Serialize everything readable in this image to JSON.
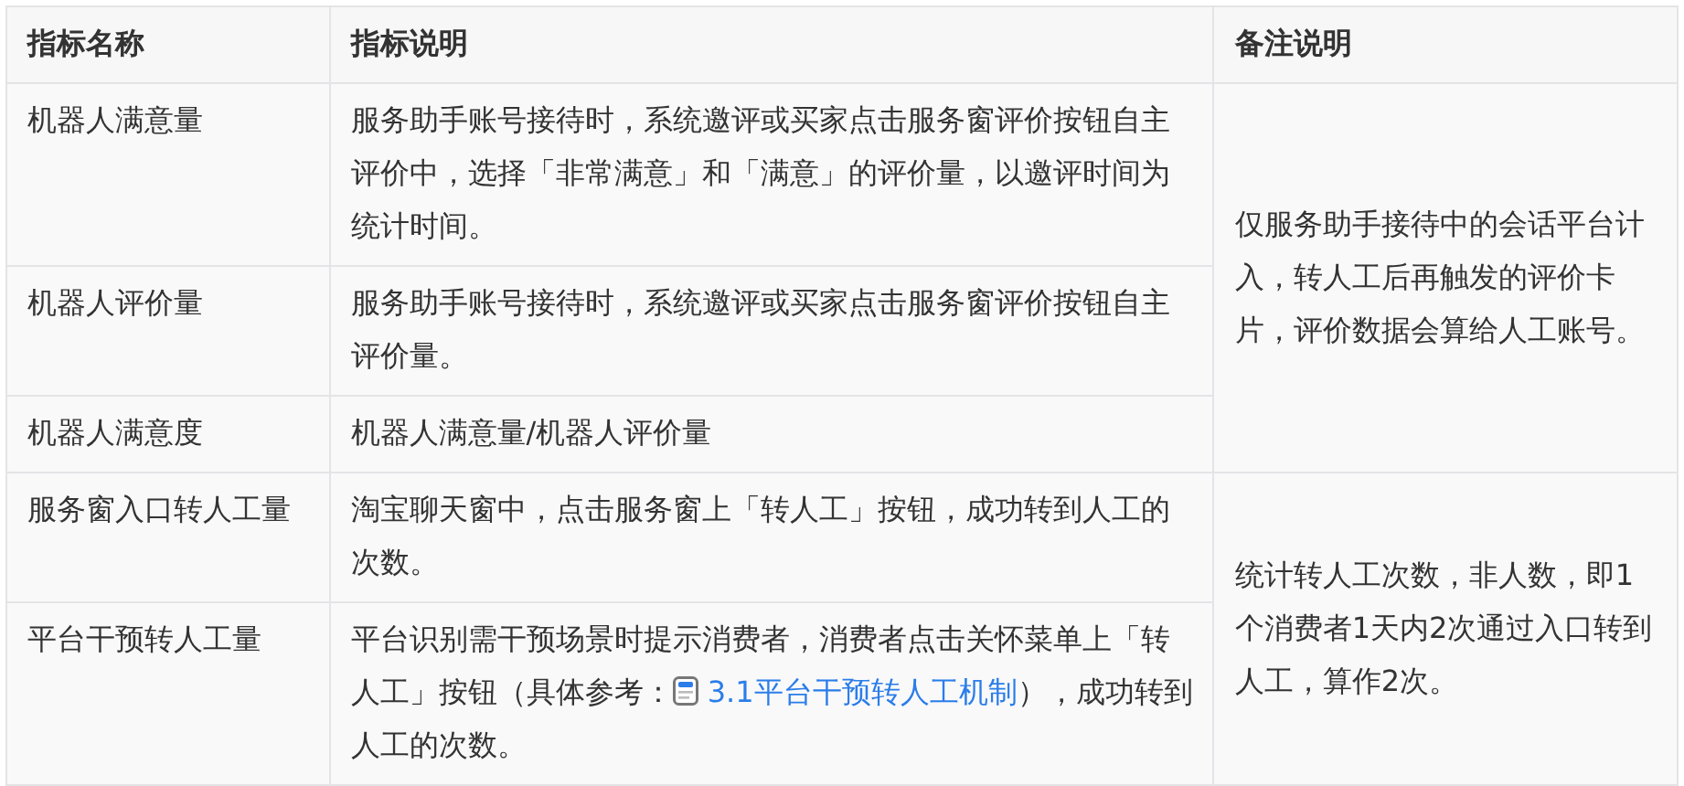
{
  "table": {
    "columns": [
      "指标名称",
      "指标说明",
      "备注说明"
    ],
    "groups": [
      {
        "note": "仅服务助手接待中的会话平台计入，转人工后再触发的评价卡片，评价数据会算给人工账号。",
        "rows": [
          {
            "name": "机器人满意量",
            "description": "服务助手账号接待时，系统邀评或买家点击服务窗评价按钮自主评价中，选择「非常满意」和「满意」的评价量，以邀评时间为统计时间。"
          },
          {
            "name": "机器人评价量",
            "description": "服务助手账号接待时，系统邀评或买家点击服务窗评价按钮自主评价量。"
          },
          {
            "name": "机器人满意度",
            "description": "机器人满意量/机器人评价量"
          }
        ]
      },
      {
        "note": "统计转人工次数，非人数，即1个消费者1天内2次通过入口转到人工，算作2次。",
        "rows": [
          {
            "name": "服务窗入口转人工量",
            "description": "淘宝聊天窗中，点击服务窗上「转人工」按钮，成功转到人工的次数。"
          },
          {
            "name": "平台干预转人工量",
            "description": "平台识别需干预场景时提示消费者，消费者点击关怀菜单上「转人工」按钮（具体参考：",
            "link": "3.1平台干预转人工机制",
            "description_end": "），成功转到人工的次数。"
          }
        ]
      }
    ]
  }
}
